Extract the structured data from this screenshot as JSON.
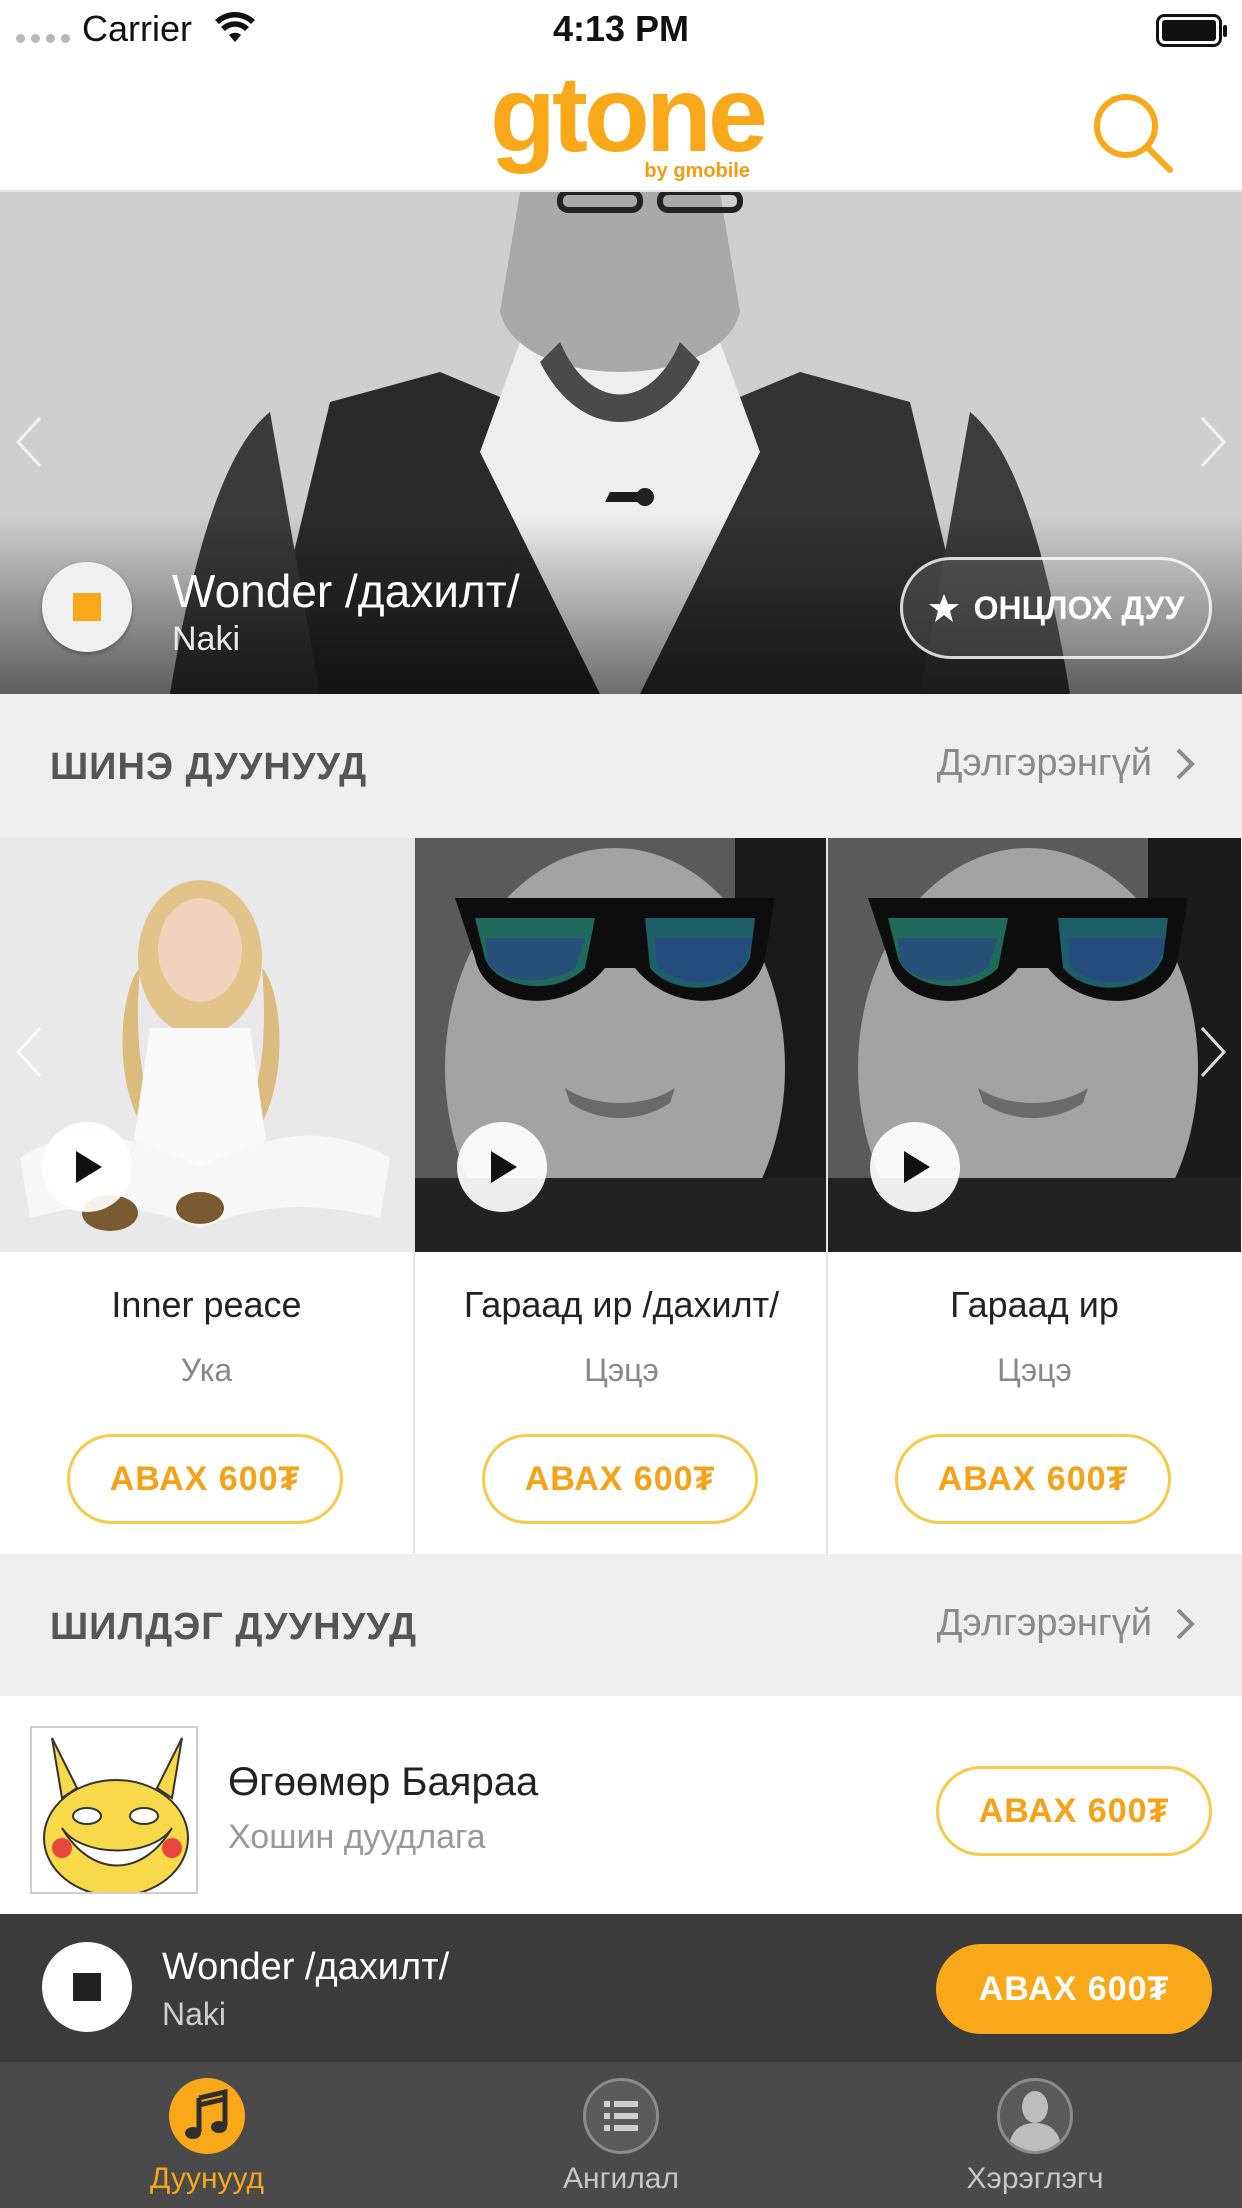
{
  "status_bar": {
    "carrier": "Carrier",
    "time": "4:13 PM"
  },
  "header": {
    "logo_text": "gtone",
    "logo_sub": "by gmobile",
    "search_icon": "search-icon",
    "brand_color": "#f9a81a"
  },
  "hero": {
    "title": "Wonder /дахилт/",
    "artist": "Naki",
    "favorite_label": "ОНЦЛОХ ДУУ",
    "favorite_icon": "star-icon",
    "play_icon": "stop-icon"
  },
  "new_songs": {
    "title": "ШИНЭ ДУУНУУД",
    "more_label": "Дэлгэрэнгүй",
    "items": [
      {
        "song": "Inner peace",
        "artist": "Ука",
        "buy_label": "АВАХ 600₮"
      },
      {
        "song": "Гараад ир /дахилт/",
        "artist": "Цэцэ",
        "buy_label": "АВАХ 600₮"
      },
      {
        "song": "Гараад ир",
        "artist": "Цэцэ",
        "buy_label": "АВАХ 600₮"
      }
    ]
  },
  "top_songs": {
    "title": "ШИЛДЭГ ДУУНУУД",
    "more_label": "Дэлгэрэнгүй",
    "items": [
      {
        "title": "Өгөөмөр Баяраа",
        "subtitle": "Хошин дуудлага",
        "buy_label": "АВАХ 600₮"
      }
    ]
  },
  "mini_player": {
    "title": "Wonder /дахилт/",
    "artist": "Naki",
    "buy_label": "АВАХ 600₮"
  },
  "tab_bar": {
    "tabs": [
      {
        "label": "Дуунууд",
        "icon": "music-note-icon",
        "active": true
      },
      {
        "label": "Ангилал",
        "icon": "list-icon",
        "active": false
      },
      {
        "label": "Хэрэглэгч",
        "icon": "user-icon",
        "active": false
      }
    ]
  }
}
